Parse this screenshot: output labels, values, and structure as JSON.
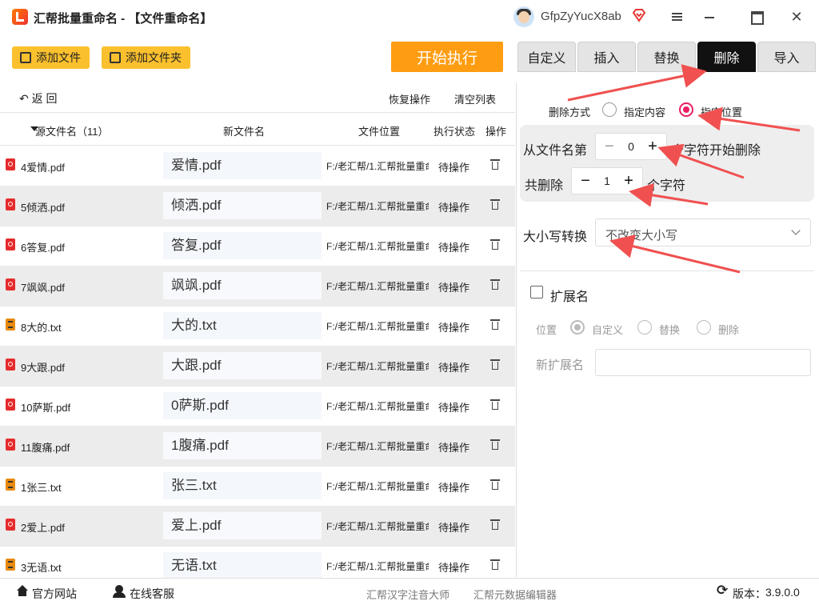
{
  "app": {
    "title": "汇帮批量重命名 - 【文件重命名】",
    "username": "GfpZyYucX8ab",
    "brand_color": "#ff9d12"
  },
  "toolbar": {
    "add_file": "添加文件",
    "add_folder": "添加文件夹",
    "start": "开始执行"
  },
  "nav": {
    "back": "返  回",
    "restore": "恢复操作",
    "clear": "清空列表"
  },
  "table": {
    "headers": {
      "src": "源文件名（11）",
      "new": "新文件名",
      "loc": "文件位置",
      "status": "执行状态",
      "op": "操作"
    },
    "rows": [
      {
        "type": "pdf",
        "src": "4爱情.pdf",
        "new": "爱情.pdf",
        "loc": "F:/老汇帮/1.汇帮批量重命名",
        "status": "待操作"
      },
      {
        "type": "pdf",
        "src": "5倾洒.pdf",
        "new": "倾洒.pdf",
        "loc": "F:/老汇帮/1.汇帮批量重命名",
        "status": "待操作"
      },
      {
        "type": "pdf",
        "src": "6答复.pdf",
        "new": "答复.pdf",
        "loc": "F:/老汇帮/1.汇帮批量重命名",
        "status": "待操作"
      },
      {
        "type": "pdf",
        "src": "7飒飒.pdf",
        "new": "飒飒.pdf",
        "loc": "F:/老汇帮/1.汇帮批量重命名",
        "status": "待操作"
      },
      {
        "type": "txt",
        "src": "8大的.txt",
        "new": "大的.txt",
        "loc": "F:/老汇帮/1.汇帮批量重命名",
        "status": "待操作"
      },
      {
        "type": "pdf",
        "src": "9大跟.pdf",
        "new": "大跟.pdf",
        "loc": "F:/老汇帮/1.汇帮批量重命名",
        "status": "待操作"
      },
      {
        "type": "pdf",
        "src": "10萨斯.pdf",
        "new": "0萨斯.pdf",
        "loc": "F:/老汇帮/1.汇帮批量重命名",
        "status": "待操作"
      },
      {
        "type": "pdf",
        "src": "11腹痛.pdf",
        "new": "1腹痛.pdf",
        "loc": "F:/老汇帮/1.汇帮批量重命名",
        "status": "待操作"
      },
      {
        "type": "txt",
        "src": "1张三.txt",
        "new": "张三.txt",
        "loc": "F:/老汇帮/1.汇帮批量重命名",
        "status": "待操作"
      },
      {
        "type": "pdf",
        "src": "2爱上.pdf",
        "new": "爱上.pdf",
        "loc": "F:/老汇帮/1.汇帮批量重命名",
        "status": "待操作"
      },
      {
        "type": "txt",
        "src": "3无语.txt",
        "new": "无语.txt",
        "loc": "F:/老汇帮/1.汇帮批量重命名",
        "status": "待操作"
      }
    ]
  },
  "tabs": [
    "自定义",
    "插入",
    "替换",
    "删除",
    "导入"
  ],
  "active_tab": "删除",
  "delete_panel": {
    "mode_label": "删除方式",
    "mode_options": [
      "指定内容",
      "指定位置"
    ],
    "mode_selected": "指定位置",
    "from_label": "从文件名第",
    "from_value": "0",
    "from_suffix": "个字符开始删除",
    "count_label": "共删除",
    "count_value": "1",
    "count_suffix": "个字符",
    "case_label": "大小写转换",
    "case_value": "不改变大小写"
  },
  "extension": {
    "label": "扩展名",
    "checked": false,
    "pos_label": "位置",
    "pos_options": [
      "自定义",
      "替换",
      "删除"
    ],
    "pos_selected": "自定义",
    "new_ext_label": "新扩展名",
    "new_ext_value": ""
  },
  "footer": {
    "site": "官方网站",
    "service": "在线客服",
    "link1": "汇帮汉字注音大师",
    "link2": "汇帮元数据编辑器",
    "version_label": "版本：",
    "version": "3.9.0.0"
  },
  "colors": {
    "accent": "#e91e63",
    "button_yellow": "#fbc02d",
    "arrow_red": "#f05050"
  }
}
